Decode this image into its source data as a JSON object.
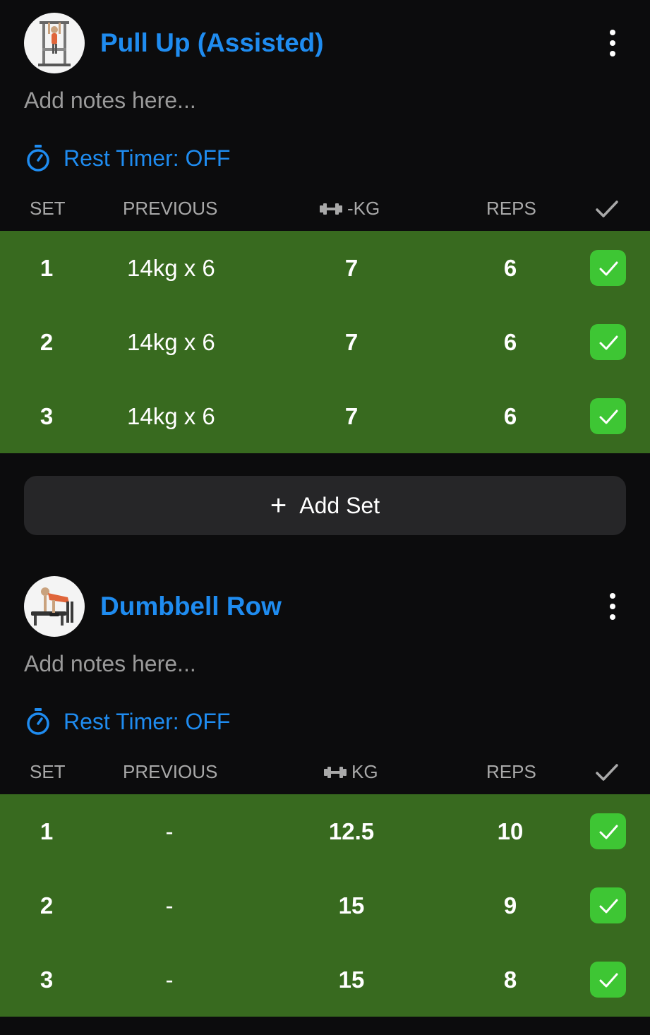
{
  "exercises": [
    {
      "title": "Pull Up (Assisted)",
      "avatar_icon": "pull-up-assisted-thumbnail",
      "notes_placeholder": "Add notes here...",
      "rest_timer": "Rest Timer: OFF",
      "columns": {
        "set": "SET",
        "previous": "PREVIOUS",
        "weight": "-KG",
        "reps": "REPS"
      },
      "sets": [
        {
          "set": "1",
          "previous": "14kg x 6",
          "weight": "7",
          "reps": "6",
          "completed": true
        },
        {
          "set": "2",
          "previous": "14kg x 6",
          "weight": "7",
          "reps": "6",
          "completed": true
        },
        {
          "set": "3",
          "previous": "14kg x 6",
          "weight": "7",
          "reps": "6",
          "completed": true
        }
      ],
      "add_set": "Add Set"
    },
    {
      "title": "Dumbbell Row",
      "avatar_icon": "dumbbell-row-thumbnail",
      "notes_placeholder": "Add notes here...",
      "rest_timer": "Rest Timer: OFF",
      "columns": {
        "set": "SET",
        "previous": "PREVIOUS",
        "weight": "KG",
        "reps": "REPS"
      },
      "sets": [
        {
          "set": "1",
          "previous": "-",
          "weight": "12.5",
          "reps": "10",
          "completed": true
        },
        {
          "set": "2",
          "previous": "-",
          "weight": "15",
          "reps": "9",
          "completed": true
        },
        {
          "set": "3",
          "previous": "-",
          "weight": "15",
          "reps": "8",
          "completed": true
        }
      ]
    }
  ],
  "colors": {
    "accent": "#1f8cf0",
    "completed_row": "#386a1f",
    "check_badge": "#3ec634",
    "background": "#0c0c0d"
  }
}
